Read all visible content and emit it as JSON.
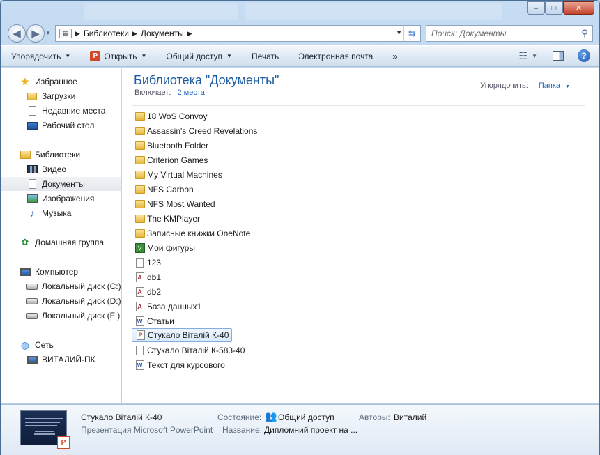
{
  "address": {
    "crumbs": [
      "Библиотеки",
      "Документы"
    ],
    "search_placeholder": "Поиск: Документы"
  },
  "window_controls": {
    "minimize": "–",
    "maximize": "□",
    "close": "✕"
  },
  "toolbar": {
    "organize": "Упорядочить",
    "open": "Открыть",
    "share": "Общий доступ",
    "print": "Печать",
    "email": "Электронная почта",
    "more": "»"
  },
  "sidebar": {
    "favorites": {
      "label": "Избранное",
      "items": [
        "Загрузки",
        "Недавние места",
        "Рабочий стол"
      ]
    },
    "libraries": {
      "label": "Библиотеки",
      "items": [
        "Видео",
        "Документы",
        "Изображения",
        "Музыка"
      ],
      "selected": "Документы"
    },
    "homegroup": "Домашняя группа",
    "computer": {
      "label": "Компьютер",
      "items": [
        "Локальный диск (C:)",
        "Локальный диск (D:)",
        "Локальный диск (F:)"
      ]
    },
    "network": {
      "label": "Сеть",
      "items": [
        "ВИТАЛИЙ-ПК"
      ]
    }
  },
  "library": {
    "title": "Библиотека \"Документы\"",
    "includes_label": "Включает:",
    "includes_value": "2 места",
    "arrange_label": "Упорядочить:",
    "arrange_value": "Папка"
  },
  "files": [
    {
      "name": "18 WoS Convoy",
      "icon": "folder"
    },
    {
      "name": "Assassin's Creed Revelations",
      "icon": "folder"
    },
    {
      "name": "Bluetooth Folder",
      "icon": "folder"
    },
    {
      "name": "Criterion Games",
      "icon": "folder"
    },
    {
      "name": "My Virtual Machines",
      "icon": "folder"
    },
    {
      "name": "NFS Carbon",
      "icon": "folder"
    },
    {
      "name": "NFS Most Wanted",
      "icon": "folder"
    },
    {
      "name": "The KMPlayer",
      "icon": "folder"
    },
    {
      "name": "Записные книжки OneNote",
      "icon": "folder"
    },
    {
      "name": "Мои фигуры",
      "icon": "visio-folder"
    },
    {
      "name": "123",
      "icon": "blank-file"
    },
    {
      "name": "db1",
      "icon": "access-file"
    },
    {
      "name": "db2",
      "icon": "access-file"
    },
    {
      "name": "База данных1",
      "icon": "access-file"
    },
    {
      "name": "Статьи",
      "icon": "word-file"
    },
    {
      "name": "Стукало Віталій К-40",
      "icon": "powerpoint-file",
      "selected": true
    },
    {
      "name": "Стукало Віталій К-583-40",
      "icon": "blank-file"
    },
    {
      "name": "Текст для курсового",
      "icon": "word-file"
    }
  ],
  "details": {
    "name": "Стукало Віталій К-40",
    "type": "Презентация Microsoft PowerPoint",
    "state_label": "Состояние:",
    "state_value": "Общий доступ",
    "authors_label": "Авторы:",
    "authors_value": "Виталий",
    "title_label": "Название:",
    "title_value": "Дипломний проект на ..."
  },
  "colors": {
    "accent": "#1e5d9e",
    "link": "#1e66c3",
    "selection": "#d9eafc"
  }
}
